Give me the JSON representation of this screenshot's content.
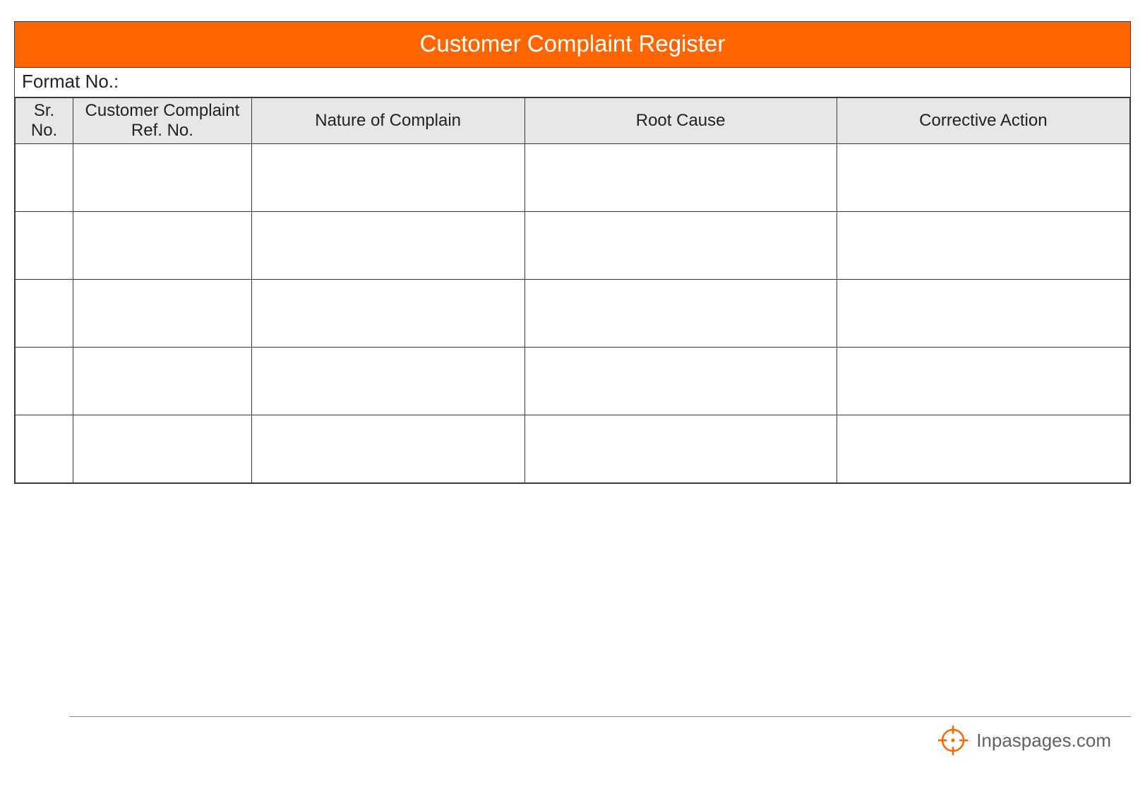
{
  "title": "Customer Complaint Register",
  "format_label": "Format No.:",
  "columns": [
    "Sr. No.",
    "Customer Complaint Ref. No.",
    "Nature of Complain",
    "Root Cause",
    "Corrective Action"
  ],
  "rows": [
    {
      "sr": "",
      "ref": "",
      "nature": "",
      "root": "",
      "corrective": ""
    },
    {
      "sr": "",
      "ref": "",
      "nature": "",
      "root": "",
      "corrective": ""
    },
    {
      "sr": "",
      "ref": "",
      "nature": "",
      "root": "",
      "corrective": ""
    },
    {
      "sr": "",
      "ref": "",
      "nature": "",
      "root": "",
      "corrective": ""
    },
    {
      "sr": "",
      "ref": "",
      "nature": "",
      "root": "",
      "corrective": ""
    }
  ],
  "brand": "Inpaspages.com",
  "colors": {
    "accent": "#ff6600",
    "header_bg": "#e7e7e7",
    "border": "#3a3a3a"
  }
}
